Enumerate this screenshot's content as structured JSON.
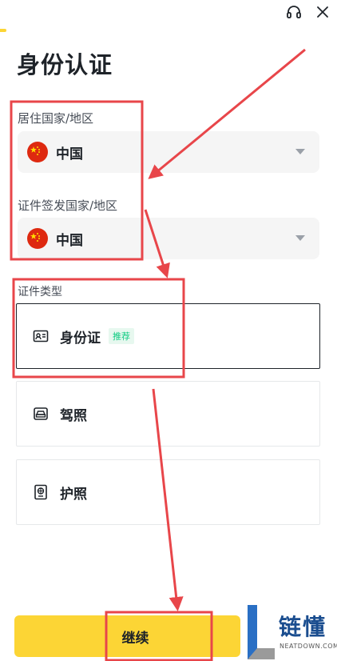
{
  "page": {
    "title": "身份认证"
  },
  "form": {
    "residence_label": "居住国家/地区",
    "residence_value": "中国",
    "issuing_label": "证件签发国家/地区",
    "issuing_value": "中国",
    "doc_type_label": "证件类型"
  },
  "documents": [
    {
      "label": "身份证",
      "badge": "推荐",
      "icon": "id-card-icon",
      "selected": true
    },
    {
      "label": "驾照",
      "icon": "car-icon",
      "selected": false
    },
    {
      "label": "护照",
      "icon": "passport-icon",
      "selected": false
    }
  ],
  "actions": {
    "continue_label": "继续"
  },
  "watermark": {
    "brand": "链懂",
    "site": "NEATDOWN.COM"
  },
  "colors": {
    "accent": "#fcd535",
    "annotation": "#e8464a",
    "badge_green": "#0ecb81"
  }
}
